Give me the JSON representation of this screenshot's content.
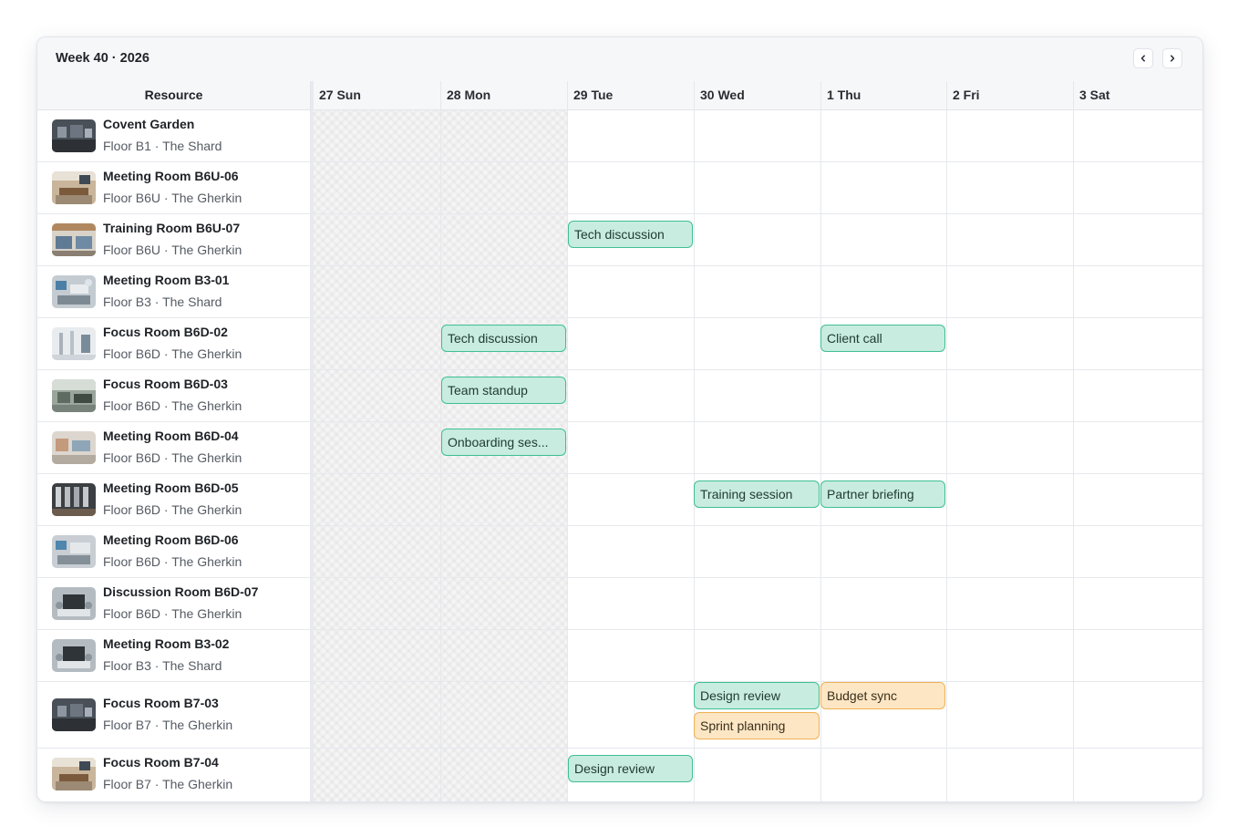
{
  "header": {
    "title": "Week 40 · 2026",
    "prev_icon": "chevron-left-icon",
    "next_icon": "chevron-right-icon"
  },
  "columns": {
    "resource_label": "Resource",
    "days": [
      "27 Sun",
      "28 Mon",
      "29 Tue",
      "30 Wed",
      "1 Thu",
      "2 Fri",
      "3 Sat"
    ]
  },
  "resources": [
    {
      "name": "Covent Garden",
      "location": "Floor B1 · The Shard"
    },
    {
      "name": "Meeting Room B6U-06",
      "location": "Floor B6U · The Gherkin"
    },
    {
      "name": "Training Room B6U-07",
      "location": "Floor B6U · The Gherkin"
    },
    {
      "name": "Meeting Room B3-01",
      "location": "Floor B3 · The Shard"
    },
    {
      "name": "Focus Room B6D-02",
      "location": "Floor B6D · The Gherkin"
    },
    {
      "name": "Focus Room B6D-03",
      "location": "Floor B6D · The Gherkin"
    },
    {
      "name": "Meeting Room B6D-04",
      "location": "Floor B6D · The Gherkin"
    },
    {
      "name": "Meeting Room B6D-05",
      "location": "Floor B6D · The Gherkin"
    },
    {
      "name": "Meeting Room B6D-06",
      "location": "Floor B6D · The Gherkin"
    },
    {
      "name": "Discussion Room B6D-07",
      "location": "Floor B6D · The Gherkin"
    },
    {
      "name": "Meeting Room B3-02",
      "location": "Floor B3 · The Shard"
    },
    {
      "name": "Focus Room B7-03",
      "location": "Floor B7 · The Gherkin"
    },
    {
      "name": "Focus Room B7-04",
      "location": "Floor B7 · The Gherkin"
    }
  ],
  "events": [
    {
      "label": "Tech discussion",
      "resource": "Training Room B6U-07",
      "day": "29 Tue",
      "color": "#c8ecdf"
    },
    {
      "label": "Tech discussion",
      "resource": "Focus Room B6D-02",
      "day": "28 Mon",
      "color": "#c8ecdf"
    },
    {
      "label": "Client call",
      "resource": "Focus Room B6D-02",
      "day": "1 Thu",
      "color": "#c8ecdf"
    },
    {
      "label": "Team standup",
      "resource": "Focus Room B6D-03",
      "day": "28 Mon",
      "color": "#c8ecdf"
    },
    {
      "label": "Onboarding ses...",
      "resource": "Meeting Room B6D-04",
      "day": "28 Mon",
      "color": "#c8ecdf"
    },
    {
      "label": "Training session",
      "resource": "Meeting Room B6D-05",
      "day": "30 Wed",
      "color": "#c8ecdf"
    },
    {
      "label": "Partner briefing",
      "resource": "Meeting Room B6D-05",
      "day": "1 Thu",
      "color": "#c8ecdf"
    },
    {
      "label": "Design review",
      "resource": "Focus Room B7-03",
      "day": "30 Wed",
      "color": "#c8ecdf"
    },
    {
      "label": "Budget sync",
      "resource": "Focus Room B7-03",
      "day": "1 Thu",
      "color": "#fde6c4"
    },
    {
      "label": "Sprint planning",
      "resource": "Focus Room B7-03",
      "day": "30 Wed",
      "color": "#fde6c4"
    },
    {
      "label": "Design review",
      "resource": "Focus Room B7-04",
      "day": "29 Tue",
      "color": "#c8ecdf"
    }
  ],
  "colors": {
    "event_green": "#c8ecdf",
    "event_green_border": "#3fbf93",
    "event_orange": "#fde6c4",
    "event_orange_border": "#efb255",
    "past_days_hatch": "#f5f5f6"
  }
}
